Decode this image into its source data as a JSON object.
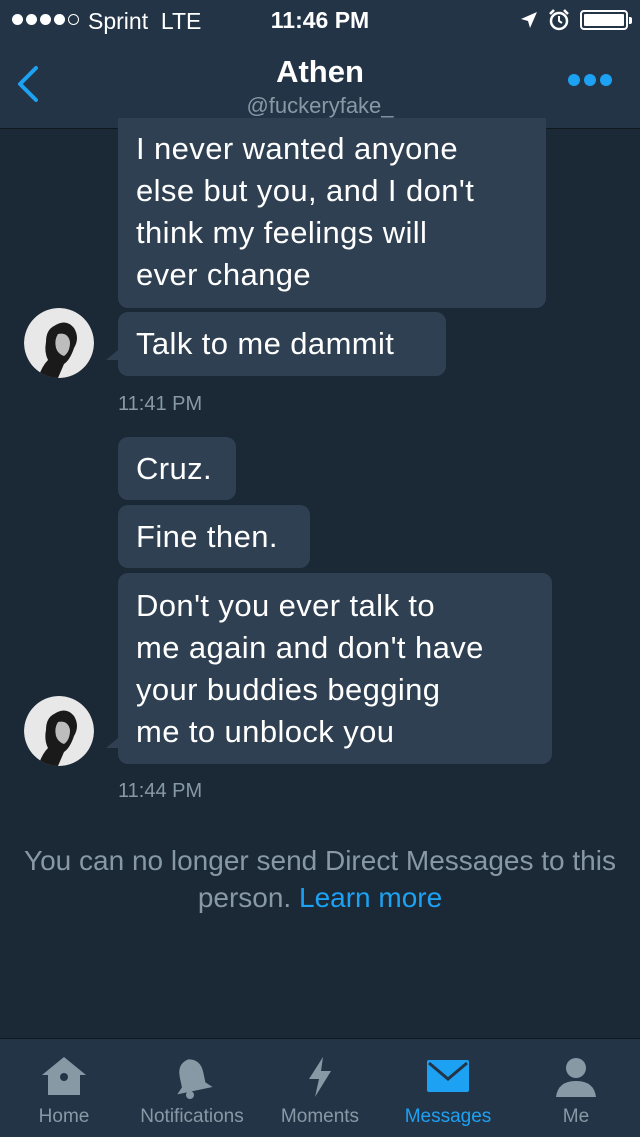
{
  "status_bar": {
    "carrier": "Sprint  LTE",
    "time": "11:46 PM"
  },
  "header": {
    "name": "Athen",
    "handle": "@fuckeryfake_"
  },
  "messages": [
    {
      "text_lines": [
        "I never wanted anyone",
        "else but you, and I don't",
        "think my feelings will",
        "ever change"
      ]
    },
    {
      "text_lines": [
        "Talk to me dammit"
      ]
    },
    {
      "timestamp": "11:41 PM"
    },
    {
      "text_lines": [
        "Cruz."
      ]
    },
    {
      "text_lines": [
        "Fine then."
      ]
    },
    {
      "text_lines": [
        "Don't you ever talk to",
        "me again and don't have",
        "your buddies begging",
        "me to unblock you"
      ]
    },
    {
      "timestamp": "11:44 PM"
    }
  ],
  "notice": {
    "text": "You can no longer send Direct Messages to this person.",
    "link": "Learn more"
  },
  "tabs": [
    {
      "label": "Home",
      "icon": "home-icon",
      "active": false
    },
    {
      "label": "Notifications",
      "icon": "bell-icon",
      "active": false
    },
    {
      "label": "Moments",
      "icon": "lightning-icon",
      "active": false
    },
    {
      "label": "Messages",
      "icon": "envelope-icon",
      "active": true
    },
    {
      "label": "Me",
      "icon": "person-icon",
      "active": false
    }
  ],
  "colors": {
    "background": "#1b2836",
    "bar": "#243447",
    "bubble": "#2f4052",
    "accent": "#1da1f2",
    "muted": "#8899a6"
  }
}
